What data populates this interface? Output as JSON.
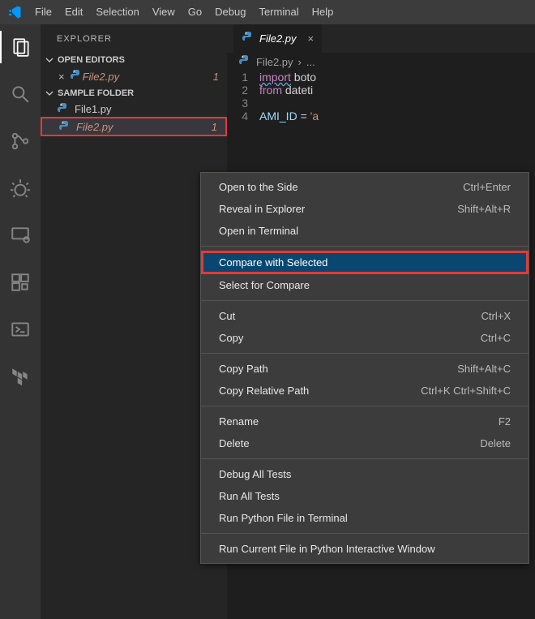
{
  "menubar": [
    "File",
    "Edit",
    "Selection",
    "View",
    "Go",
    "Debug",
    "Terminal",
    "Help"
  ],
  "explorer": {
    "title": "EXPLORER",
    "open_editors_label": "OPEN EDITORS",
    "open_editor_file": "File2.py",
    "open_editor_count": "1",
    "folder_label": "SAMPLE FOLDER",
    "files": [
      {
        "name": "File1.py"
      },
      {
        "name": "File2.py",
        "count": "1",
        "selected": true
      }
    ]
  },
  "tab": {
    "name": "File2.py"
  },
  "breadcrumb": {
    "file": "File2.py",
    "ellipsis": "..."
  },
  "code_lines": {
    "l1_kw": "import",
    "l1_rest": " boto",
    "l2_kw": "from",
    "l2_rest": " dateti",
    "l4_var": "AMI_ID",
    "l4_eq": " = ",
    "l4_str": "'a"
  },
  "contextmenu": {
    "items": [
      {
        "label": "Open to the Side",
        "shortcut": "Ctrl+Enter"
      },
      {
        "label": "Reveal in Explorer",
        "shortcut": "Shift+Alt+R"
      },
      {
        "label": "Open in Terminal",
        "shortcut": ""
      },
      {
        "sep": true
      },
      {
        "label": "Compare with Selected",
        "shortcut": "",
        "highlighted": true
      },
      {
        "label": "Select for Compare",
        "shortcut": ""
      },
      {
        "sep": true
      },
      {
        "label": "Cut",
        "shortcut": "Ctrl+X"
      },
      {
        "label": "Copy",
        "shortcut": "Ctrl+C"
      },
      {
        "sep": true
      },
      {
        "label": "Copy Path",
        "shortcut": "Shift+Alt+C"
      },
      {
        "label": "Copy Relative Path",
        "shortcut": "Ctrl+K Ctrl+Shift+C"
      },
      {
        "sep": true
      },
      {
        "label": "Rename",
        "shortcut": "F2"
      },
      {
        "label": "Delete",
        "shortcut": "Delete"
      },
      {
        "sep": true
      },
      {
        "label": "Debug All Tests",
        "shortcut": ""
      },
      {
        "label": "Run All Tests",
        "shortcut": ""
      },
      {
        "label": "Run Python File in Terminal",
        "shortcut": ""
      },
      {
        "sep": true
      },
      {
        "label": "Run Current File in Python Interactive Window",
        "shortcut": ""
      }
    ]
  }
}
